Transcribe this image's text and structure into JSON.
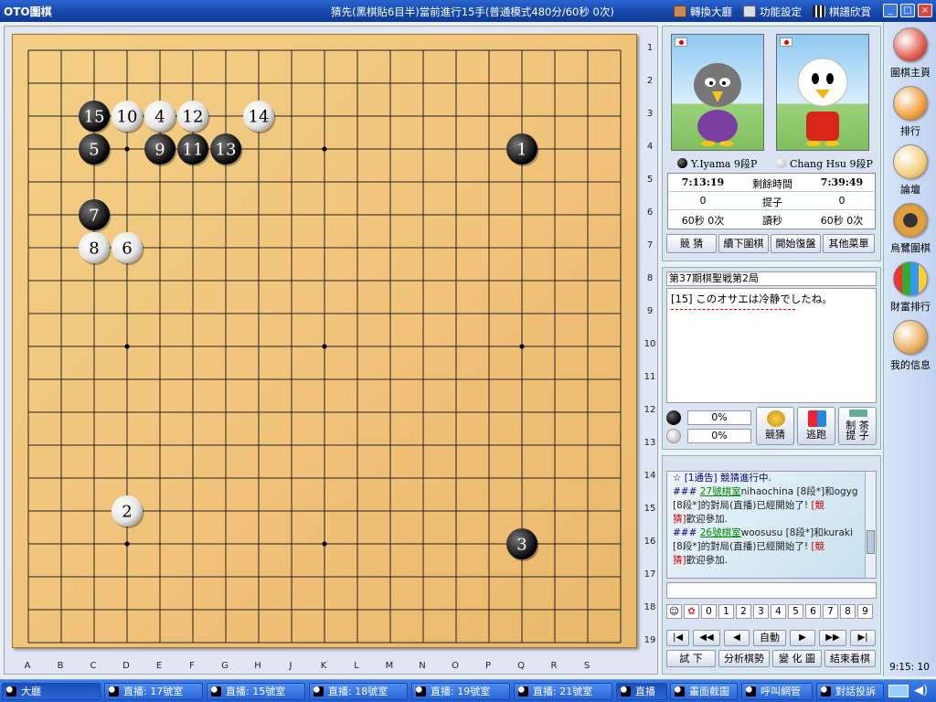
{
  "app": {
    "logo": "OTO圍棋",
    "title": "猜先(黑棋貼6目半)當前進行15手(普通模式480分/60秒 0次)",
    "nav": {
      "lobby": "轉換大廳",
      "functions": "功能設定",
      "kifu": "棋譜欣賞"
    }
  },
  "board": {
    "size": 19,
    "row_labels": [
      "1",
      "2",
      "3",
      "4",
      "5",
      "6",
      "7",
      "8",
      "9",
      "10",
      "11",
      "12",
      "13",
      "14",
      "15",
      "16",
      "17",
      "18",
      "19"
    ],
    "col_labels": [
      "A",
      "B",
      "C",
      "D",
      "E",
      "F",
      "G",
      "H",
      "J",
      "K",
      "L",
      "M",
      "N",
      "O",
      "P",
      "Q",
      "R",
      "S"
    ],
    "hoshi": [
      [
        3,
        3
      ],
      [
        9,
        3
      ],
      [
        15,
        3
      ],
      [
        3,
        9
      ],
      [
        9,
        9
      ],
      [
        15,
        9
      ],
      [
        3,
        15
      ],
      [
        9,
        15
      ],
      [
        15,
        15
      ]
    ],
    "stones": [
      {
        "n": "1",
        "color": "black",
        "col": 15,
        "row": 3
      },
      {
        "n": "2",
        "color": "white",
        "col": 3,
        "row": 14
      },
      {
        "n": "3",
        "color": "black",
        "col": 15,
        "row": 15
      },
      {
        "n": "4",
        "color": "white",
        "col": 4,
        "row": 2
      },
      {
        "n": "5",
        "color": "black",
        "col": 2,
        "row": 3
      },
      {
        "n": "6",
        "color": "white",
        "col": 3,
        "row": 6
      },
      {
        "n": "7",
        "color": "black",
        "col": 2,
        "row": 5
      },
      {
        "n": "8",
        "color": "white",
        "col": 2,
        "row": 6
      },
      {
        "n": "9",
        "color": "black",
        "col": 4,
        "row": 3
      },
      {
        "n": "10",
        "color": "white",
        "col": 3,
        "row": 2
      },
      {
        "n": "11",
        "color": "black",
        "col": 5,
        "row": 3
      },
      {
        "n": "12",
        "color": "white",
        "col": 5,
        "row": 2
      },
      {
        "n": "13",
        "color": "black",
        "col": 6,
        "row": 3
      },
      {
        "n": "14",
        "color": "white",
        "col": 7,
        "row": 2
      },
      {
        "n": "15",
        "color": "black",
        "col": 2,
        "row": 2
      }
    ]
  },
  "players": {
    "black": {
      "name": "Y.Iyama",
      "rank": "9段P",
      "time": "7:13:19",
      "captures": "0",
      "byoyomi": "60秒 0次"
    },
    "white": {
      "name": "Chang Hsu",
      "rank": "9段P",
      "time": "7:39:49",
      "captures": "0",
      "byoyomi": "60秒 0次"
    }
  },
  "clock_labels": {
    "remaining": "剩餘時間",
    "captures": "提子",
    "byoyomi": "讀秒"
  },
  "controls": [
    "競 猜",
    "續下圍棋",
    "開始復盤",
    "其他菜單"
  ],
  "comment": {
    "game_title": "第37期棋聖戦第2局",
    "text": "[15] このオサエは冷静でしたね。"
  },
  "betting": {
    "black_pct": "0%",
    "white_pct": "0%",
    "guess": "競猜",
    "escape": "逃跑",
    "tea_1": "制 茶",
    "tea_2": "提 子"
  },
  "chat": {
    "lines": [
      {
        "segs": [
          {
            "t": "☆ [1通告] 競猜進行中.",
            "c": "b"
          }
        ]
      },
      {
        "segs": [
          {
            "t": "### ",
            "c": "b"
          },
          {
            "t": "27號棋室",
            "c": "g"
          },
          {
            "t": "nihaochina [8段*]和ogyg",
            "c": ""
          }
        ]
      },
      {
        "segs": [
          {
            "t": "[8段*]的對局(直播)已經開始了! ",
            "c": ""
          },
          {
            "t": "[競",
            "c": "r"
          }
        ]
      },
      {
        "segs": [
          {
            "t": "猜]",
            "c": "r"
          },
          {
            "t": "歡迎參加.",
            "c": ""
          }
        ]
      },
      {
        "segs": [
          {
            "t": "### ",
            "c": "b"
          },
          {
            "t": "26號棋室",
            "c": "g"
          },
          {
            "t": "woosusu [8段*]和kuraki",
            "c": ""
          }
        ]
      },
      {
        "segs": [
          {
            "t": "[8段*]的對局(直播)已經開始了! ",
            "c": ""
          },
          {
            "t": "[競",
            "c": "r"
          }
        ]
      },
      {
        "segs": [
          {
            "t": "猜]",
            "c": "r"
          },
          {
            "t": "歡迎參加.",
            "c": ""
          }
        ]
      }
    ],
    "emotes": [
      "0",
      "1",
      "2",
      "3",
      "4",
      "5",
      "6",
      "7",
      "8",
      "9"
    ]
  },
  "nav_buttons": {
    "first": "|◀",
    "prev10": "◀◀",
    "prev": "◀",
    "auto": "自動",
    "next": "▶",
    "next10": "▶▶",
    "last": "▶|"
  },
  "tools": [
    "試 下",
    "分析棋勢",
    "變 化 圖",
    "結束看棋"
  ],
  "sidebar": [
    "圍棋主頁",
    "排行",
    "論壇",
    "烏鷺圍棋",
    "財富排行",
    "我的信息"
  ],
  "clock": "9:15: 10",
  "taskbar": [
    "大廳",
    "直播: 17號室",
    "直播: 15號室",
    "直播: 18號室",
    "直播: 19號室",
    "直播: 21號室",
    "直播",
    "畫面截圖",
    "呼叫網管",
    "對話投訴"
  ]
}
